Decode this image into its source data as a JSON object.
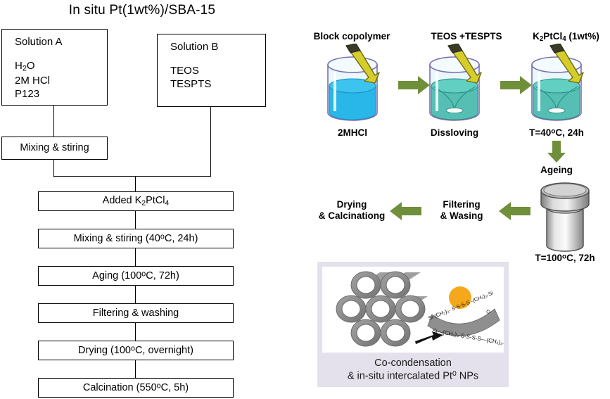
{
  "title": "In situ Pt(1wt%)/SBA-15",
  "flowchart": {
    "solution_a": {
      "name": "Solution A",
      "items": [
        "H2O",
        "2M HCl",
        "P123"
      ]
    },
    "solution_b": {
      "name": "Solution B",
      "items": [
        "TEOS",
        "TESPTS"
      ]
    },
    "steps": [
      {
        "label": "Mixing & stiring"
      },
      {
        "label": "Added K2PtCl4"
      },
      {
        "label": "Mixing & stiring (40°C, 24h)"
      },
      {
        "label": "Aging (100°C, 72h)"
      },
      {
        "label": "Filtering & washing"
      },
      {
        "label": "Drying (100°C, overnight)"
      },
      {
        "label": "Calcination (550°C, 5h)"
      }
    ]
  },
  "process": {
    "steps": [
      {
        "reagent": "Block copolymer",
        "caption": "2MHCl"
      },
      {
        "reagent": "TEOS +TESPTS",
        "caption": "Dissloving"
      },
      {
        "reagent": "K2PtCl4 (1wt%)",
        "caption": "T=40°C, 24h"
      }
    ],
    "ageing_label": "Ageing",
    "autoclave_caption": "T=100°C, 72h",
    "filtering_label_line1": "Filtering",
    "filtering_label_line2": "& Wasing",
    "drying_label_line1": "Drying",
    "drying_label_line2": "& Calcinationg"
  },
  "inset": {
    "caption_line1": "Co-condensation",
    "caption_line2": "& in-situ intercalated Pt0 NPs",
    "molecule_outer": "Si–(CH2)3-S-S-S-S–(CH2)3",
    "molecule_inner": "Si–(CH2)3-S-S-S-S–(CH2)3–Si"
  },
  "colors": {
    "arrow_green": "#6f8f3a",
    "reagent_yellow": "#d6cd2a",
    "liquid_cyan": "#29b6e8",
    "liquid_teal": "#55bfb4",
    "glass_outline": "#7b6fb0",
    "pore_gray": "#8d8d8d",
    "nanoparticle": "#f5a81c",
    "inset_bg": "#e4e1ec"
  }
}
